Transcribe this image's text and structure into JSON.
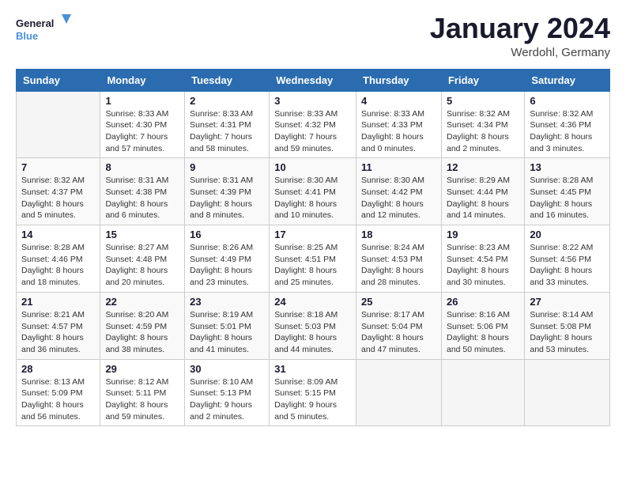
{
  "logo": {
    "text_general": "General",
    "text_blue": "Blue"
  },
  "header": {
    "month": "January 2024",
    "location": "Werdohl, Germany"
  },
  "days_of_week": [
    "Sunday",
    "Monday",
    "Tuesday",
    "Wednesday",
    "Thursday",
    "Friday",
    "Saturday"
  ],
  "weeks": [
    [
      {
        "day": "",
        "sunrise": "",
        "sunset": "",
        "daylight": ""
      },
      {
        "day": "1",
        "sunrise": "Sunrise: 8:33 AM",
        "sunset": "Sunset: 4:30 PM",
        "daylight": "Daylight: 7 hours and 57 minutes."
      },
      {
        "day": "2",
        "sunrise": "Sunrise: 8:33 AM",
        "sunset": "Sunset: 4:31 PM",
        "daylight": "Daylight: 7 hours and 58 minutes."
      },
      {
        "day": "3",
        "sunrise": "Sunrise: 8:33 AM",
        "sunset": "Sunset: 4:32 PM",
        "daylight": "Daylight: 7 hours and 59 minutes."
      },
      {
        "day": "4",
        "sunrise": "Sunrise: 8:33 AM",
        "sunset": "Sunset: 4:33 PM",
        "daylight": "Daylight: 8 hours and 0 minutes."
      },
      {
        "day": "5",
        "sunrise": "Sunrise: 8:32 AM",
        "sunset": "Sunset: 4:34 PM",
        "daylight": "Daylight: 8 hours and 2 minutes."
      },
      {
        "day": "6",
        "sunrise": "Sunrise: 8:32 AM",
        "sunset": "Sunset: 4:36 PM",
        "daylight": "Daylight: 8 hours and 3 minutes."
      }
    ],
    [
      {
        "day": "7",
        "sunrise": "Sunrise: 8:32 AM",
        "sunset": "Sunset: 4:37 PM",
        "daylight": "Daylight: 8 hours and 5 minutes."
      },
      {
        "day": "8",
        "sunrise": "Sunrise: 8:31 AM",
        "sunset": "Sunset: 4:38 PM",
        "daylight": "Daylight: 8 hours and 6 minutes."
      },
      {
        "day": "9",
        "sunrise": "Sunrise: 8:31 AM",
        "sunset": "Sunset: 4:39 PM",
        "daylight": "Daylight: 8 hours and 8 minutes."
      },
      {
        "day": "10",
        "sunrise": "Sunrise: 8:30 AM",
        "sunset": "Sunset: 4:41 PM",
        "daylight": "Daylight: 8 hours and 10 minutes."
      },
      {
        "day": "11",
        "sunrise": "Sunrise: 8:30 AM",
        "sunset": "Sunset: 4:42 PM",
        "daylight": "Daylight: 8 hours and 12 minutes."
      },
      {
        "day": "12",
        "sunrise": "Sunrise: 8:29 AM",
        "sunset": "Sunset: 4:44 PM",
        "daylight": "Daylight: 8 hours and 14 minutes."
      },
      {
        "day": "13",
        "sunrise": "Sunrise: 8:28 AM",
        "sunset": "Sunset: 4:45 PM",
        "daylight": "Daylight: 8 hours and 16 minutes."
      }
    ],
    [
      {
        "day": "14",
        "sunrise": "Sunrise: 8:28 AM",
        "sunset": "Sunset: 4:46 PM",
        "daylight": "Daylight: 8 hours and 18 minutes."
      },
      {
        "day": "15",
        "sunrise": "Sunrise: 8:27 AM",
        "sunset": "Sunset: 4:48 PM",
        "daylight": "Daylight: 8 hours and 20 minutes."
      },
      {
        "day": "16",
        "sunrise": "Sunrise: 8:26 AM",
        "sunset": "Sunset: 4:49 PM",
        "daylight": "Daylight: 8 hours and 23 minutes."
      },
      {
        "day": "17",
        "sunrise": "Sunrise: 8:25 AM",
        "sunset": "Sunset: 4:51 PM",
        "daylight": "Daylight: 8 hours and 25 minutes."
      },
      {
        "day": "18",
        "sunrise": "Sunrise: 8:24 AM",
        "sunset": "Sunset: 4:53 PM",
        "daylight": "Daylight: 8 hours and 28 minutes."
      },
      {
        "day": "19",
        "sunrise": "Sunrise: 8:23 AM",
        "sunset": "Sunset: 4:54 PM",
        "daylight": "Daylight: 8 hours and 30 minutes."
      },
      {
        "day": "20",
        "sunrise": "Sunrise: 8:22 AM",
        "sunset": "Sunset: 4:56 PM",
        "daylight": "Daylight: 8 hours and 33 minutes."
      }
    ],
    [
      {
        "day": "21",
        "sunrise": "Sunrise: 8:21 AM",
        "sunset": "Sunset: 4:57 PM",
        "daylight": "Daylight: 8 hours and 36 minutes."
      },
      {
        "day": "22",
        "sunrise": "Sunrise: 8:20 AM",
        "sunset": "Sunset: 4:59 PM",
        "daylight": "Daylight: 8 hours and 38 minutes."
      },
      {
        "day": "23",
        "sunrise": "Sunrise: 8:19 AM",
        "sunset": "Sunset: 5:01 PM",
        "daylight": "Daylight: 8 hours and 41 minutes."
      },
      {
        "day": "24",
        "sunrise": "Sunrise: 8:18 AM",
        "sunset": "Sunset: 5:03 PM",
        "daylight": "Daylight: 8 hours and 44 minutes."
      },
      {
        "day": "25",
        "sunrise": "Sunrise: 8:17 AM",
        "sunset": "Sunset: 5:04 PM",
        "daylight": "Daylight: 8 hours and 47 minutes."
      },
      {
        "day": "26",
        "sunrise": "Sunrise: 8:16 AM",
        "sunset": "Sunset: 5:06 PM",
        "daylight": "Daylight: 8 hours and 50 minutes."
      },
      {
        "day": "27",
        "sunrise": "Sunrise: 8:14 AM",
        "sunset": "Sunset: 5:08 PM",
        "daylight": "Daylight: 8 hours and 53 minutes."
      }
    ],
    [
      {
        "day": "28",
        "sunrise": "Sunrise: 8:13 AM",
        "sunset": "Sunset: 5:09 PM",
        "daylight": "Daylight: 8 hours and 56 minutes."
      },
      {
        "day": "29",
        "sunrise": "Sunrise: 8:12 AM",
        "sunset": "Sunset: 5:11 PM",
        "daylight": "Daylight: 8 hours and 59 minutes."
      },
      {
        "day": "30",
        "sunrise": "Sunrise: 8:10 AM",
        "sunset": "Sunset: 5:13 PM",
        "daylight": "Daylight: 9 hours and 2 minutes."
      },
      {
        "day": "31",
        "sunrise": "Sunrise: 8:09 AM",
        "sunset": "Sunset: 5:15 PM",
        "daylight": "Daylight: 9 hours and 5 minutes."
      },
      {
        "day": "",
        "sunrise": "",
        "sunset": "",
        "daylight": ""
      },
      {
        "day": "",
        "sunrise": "",
        "sunset": "",
        "daylight": ""
      },
      {
        "day": "",
        "sunrise": "",
        "sunset": "",
        "daylight": ""
      }
    ]
  ]
}
